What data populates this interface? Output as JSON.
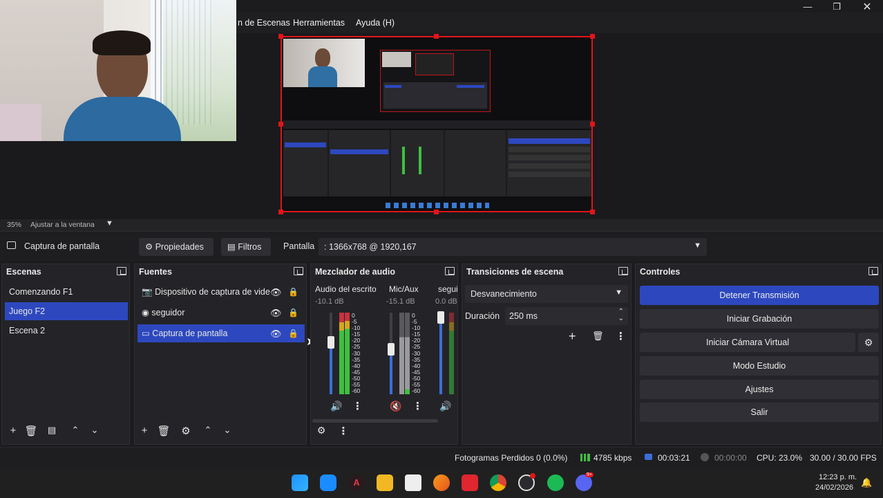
{
  "menu": {
    "items": [
      "n de Escenas",
      "Herramientas",
      "Ayuda (H)"
    ]
  },
  "zoombar": {
    "zoom": "35%",
    "fit": "Ajustar a la ventana"
  },
  "source_toolbar": {
    "source_name": "Captura de pantalla",
    "properties": "Propiedades",
    "filters": "Filtros",
    "display_label": "Pantalla",
    "display_value": ": 1366x768 @ 1920,167"
  },
  "scenes": {
    "title": "Escenas",
    "items": [
      "Comenzando F1",
      "Juego F2",
      "Escena 2"
    ],
    "selected_index": 1
  },
  "sources": {
    "title": "Fuentes",
    "items": [
      "Dispositivo de captura de vide",
      "seguidor",
      "Captura de pantalla"
    ],
    "selected_index": 2
  },
  "mixer": {
    "title": "Mezclador de audio",
    "channels": [
      {
        "name": "Audio del escrito",
        "db": "-10.1 dB"
      },
      {
        "name": "Mic/Aux",
        "db": "-15.1 dB"
      },
      {
        "name": "segui",
        "db": "0.0 dB"
      }
    ],
    "scale": [
      "0",
      "-5",
      "-10",
      "-15",
      "-20",
      "-25",
      "-30",
      "-35",
      "-40",
      "-45",
      "-50",
      "-55",
      "-60"
    ]
  },
  "transitions": {
    "title": "Transiciones de escena",
    "selected": "Desvanecimiento",
    "duration_label": "Duración",
    "duration_value": "250 ms"
  },
  "controls": {
    "title": "Controles",
    "buttons": [
      "Detener Transmisión",
      "Iniciar Grabación",
      "Iniciar Cámara Virtual",
      "Modo Estudio",
      "Ajustes",
      "Salir"
    ]
  },
  "status": {
    "dropped": "Fotogramas Perdidos 0 (0.0%)",
    "bitrate": "4785 kbps",
    "live_time": "00:03:21",
    "rec_time": "00:00:00",
    "cpu": "CPU: 23.0%",
    "fps": "30.00 / 30.00 FPS"
  },
  "taskbar": {
    "time": "12:23 p. m.",
    "date": "24/02/2026",
    "discord_badge": "9+"
  },
  "colors": {
    "accent": "#2d48bf",
    "selection_red": "#e0151a",
    "meter_green": "#3fbf3f",
    "meter_red": "#c8333f"
  }
}
